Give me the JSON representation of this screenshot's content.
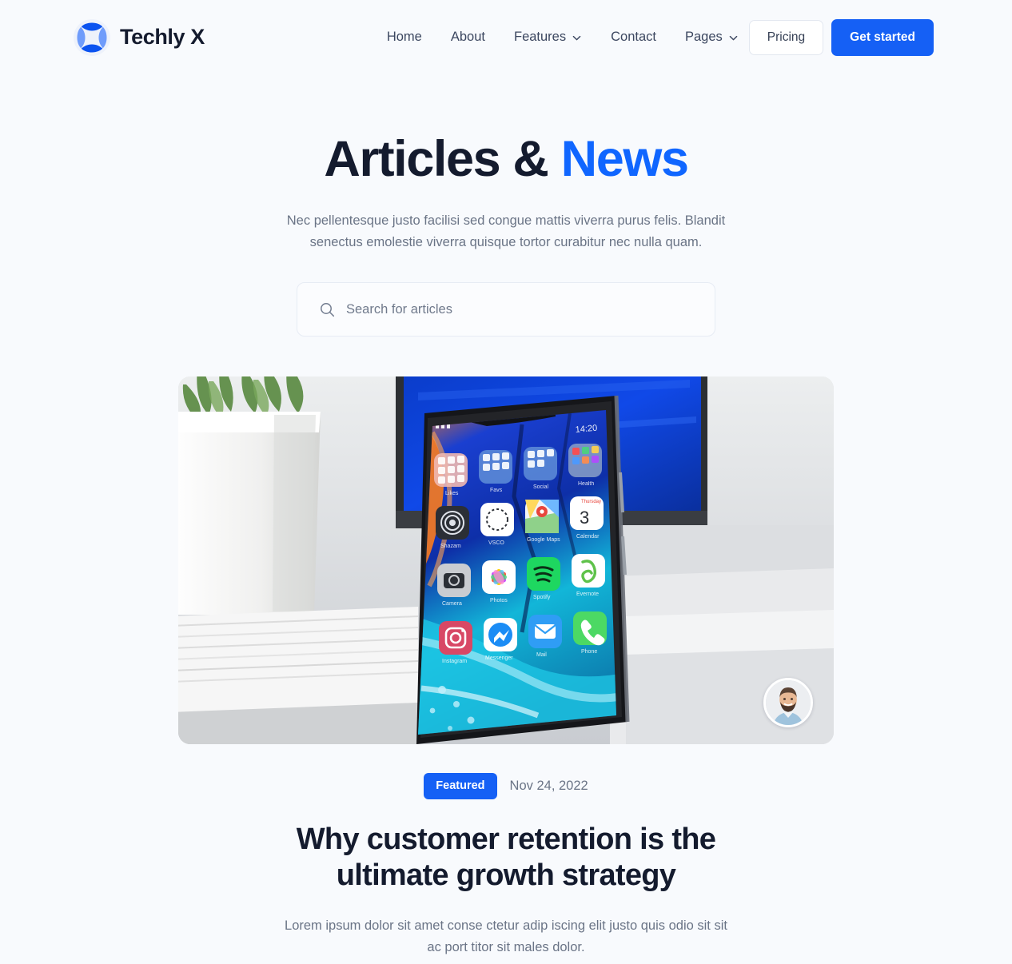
{
  "theme": {
    "background": "#f8fafd",
    "primary_blue": "#1560f5",
    "accent_blue": "#1066ff",
    "ink": "#141b2e",
    "muted": "#6a7486"
  },
  "header": {
    "logo_icon": "four-petal-circle-logo",
    "brand": "Techly X",
    "nav": [
      {
        "label": "Home",
        "has_dropdown": false
      },
      {
        "label": "About",
        "has_dropdown": false
      },
      {
        "label": "Features",
        "has_dropdown": true
      },
      {
        "label": "Contact",
        "has_dropdown": false
      },
      {
        "label": "Pages",
        "has_dropdown": true
      }
    ],
    "pricing_label": "Pricing",
    "get_started_label": "Get started"
  },
  "hero": {
    "title_main": "Articles & ",
    "title_accent": "News",
    "subtitle": "Nec pellentesque justo facilisi sed congue mattis viverra purus felis. Blandit senectus emolestie viverra quisque tortor curabitur nec nulla quam."
  },
  "search": {
    "icon": "search-icon",
    "placeholder": "Search for articles",
    "value": ""
  },
  "featured_post": {
    "image_alt": "Smartphone with colorful app icons standing on white papers in front of a blue computer monitor",
    "author_avatar": "bearded-man-in-light-blue-shirt",
    "badge": "Featured",
    "date": "Nov 24, 2022",
    "title": "Why customer retention is the ultimate growth strategy",
    "excerpt": "Lorem ipsum dolor sit amet conse ctetur adip iscing elit justo quis odio sit sit ac port titor sit males dolor."
  }
}
